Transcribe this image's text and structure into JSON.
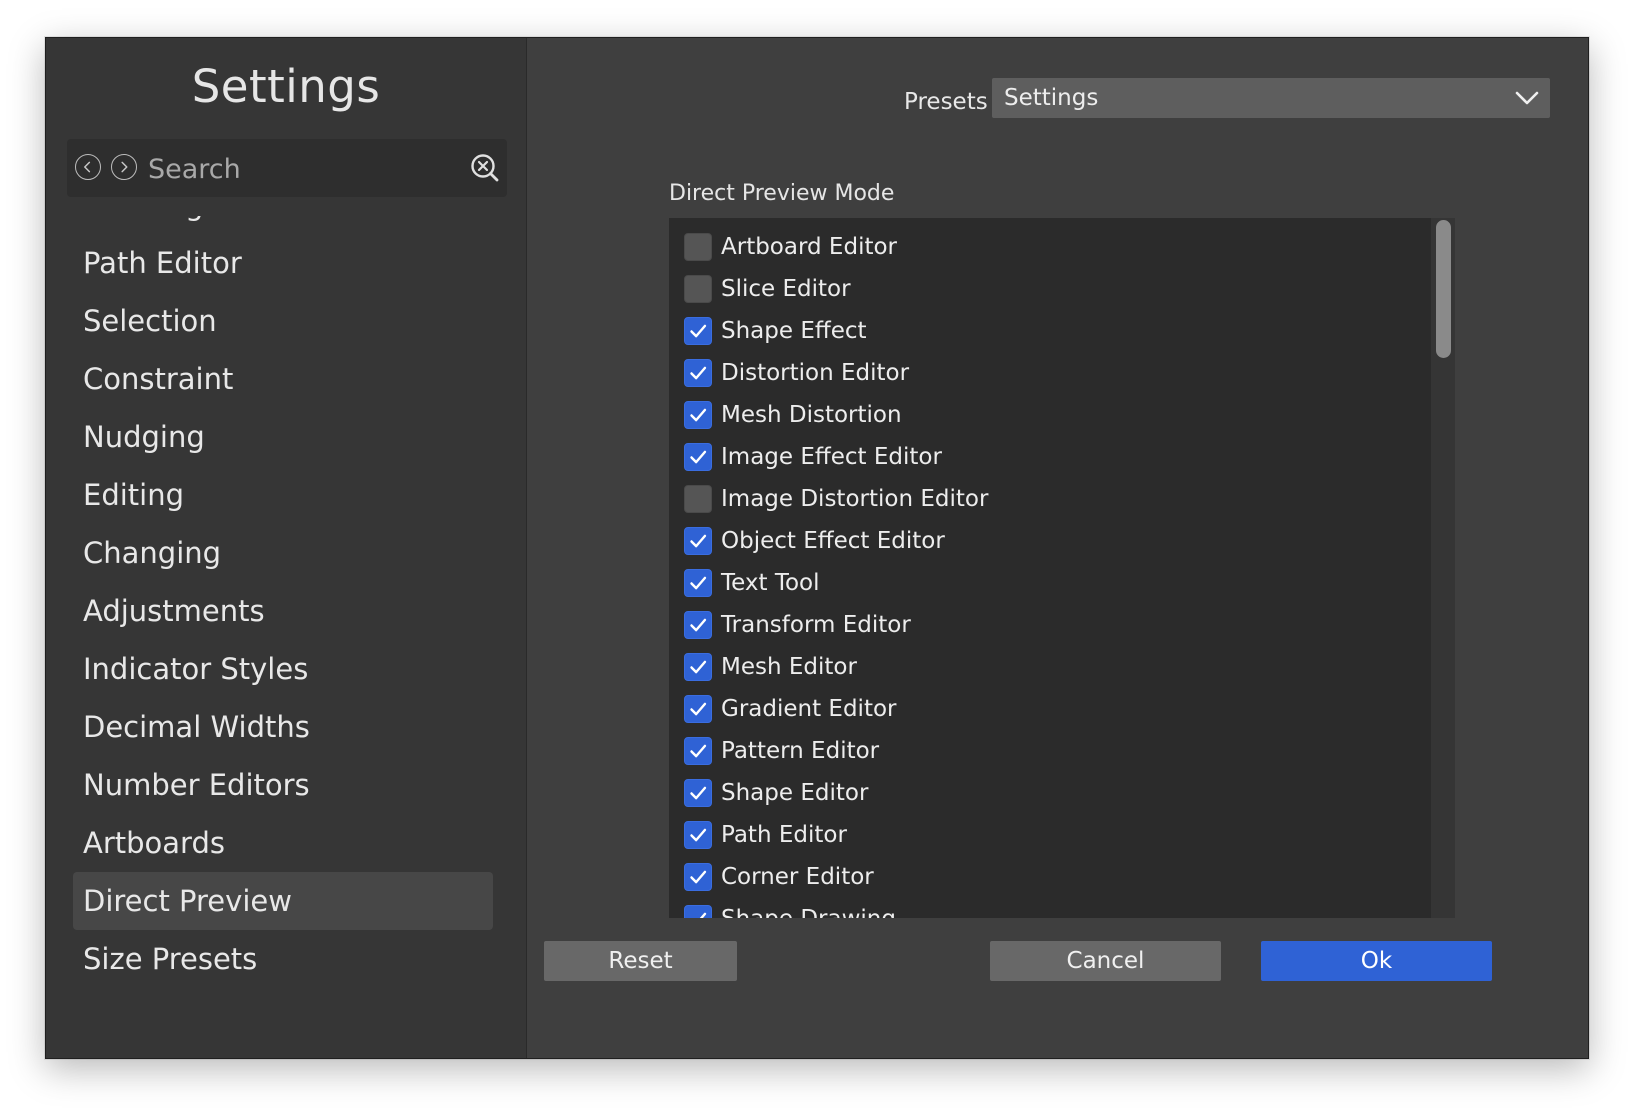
{
  "sidebar": {
    "title": "Settings",
    "search": {
      "placeholder": "Search",
      "value": ""
    },
    "items": [
      {
        "label": "Drawing",
        "selected": false
      },
      {
        "label": "Path Editor",
        "selected": false
      },
      {
        "label": "Selection",
        "selected": false
      },
      {
        "label": "Constraint",
        "selected": false
      },
      {
        "label": "Nudging",
        "selected": false
      },
      {
        "label": "Editing",
        "selected": false
      },
      {
        "label": "Changing",
        "selected": false
      },
      {
        "label": "Adjustments",
        "selected": false
      },
      {
        "label": "Indicator Styles",
        "selected": false
      },
      {
        "label": "Decimal Widths",
        "selected": false
      },
      {
        "label": "Number Editors",
        "selected": false
      },
      {
        "label": "Artboards",
        "selected": false
      },
      {
        "label": "Direct Preview",
        "selected": true
      },
      {
        "label": "Size Presets",
        "selected": false
      }
    ]
  },
  "presets": {
    "label": "Presets",
    "value": "Settings"
  },
  "direct_preview": {
    "section_label": "Direct Preview Mode",
    "items": [
      {
        "label": "Artboard Editor",
        "checked": false
      },
      {
        "label": "Slice Editor",
        "checked": false
      },
      {
        "label": "Shape Effect",
        "checked": true
      },
      {
        "label": "Distortion Editor",
        "checked": true
      },
      {
        "label": "Mesh Distortion",
        "checked": true
      },
      {
        "label": "Image Effect Editor",
        "checked": true
      },
      {
        "label": "Image Distortion Editor",
        "checked": false
      },
      {
        "label": "Object Effect Editor",
        "checked": true
      },
      {
        "label": "Text Tool",
        "checked": true
      },
      {
        "label": "Transform Editor",
        "checked": true
      },
      {
        "label": "Mesh Editor",
        "checked": true
      },
      {
        "label": "Gradient Editor",
        "checked": true
      },
      {
        "label": "Pattern Editor",
        "checked": true
      },
      {
        "label": "Shape Editor",
        "checked": true
      },
      {
        "label": "Path Editor",
        "checked": true
      },
      {
        "label": "Corner Editor",
        "checked": true
      },
      {
        "label": "Shape Drawing",
        "checked": true
      }
    ]
  },
  "buttons": {
    "reset": "Reset",
    "cancel": "Cancel",
    "ok": "Ok"
  },
  "colors": {
    "accent": "#2f62d5",
    "window_bg": "#3f3f3f",
    "sidebar_bg": "#363636"
  }
}
